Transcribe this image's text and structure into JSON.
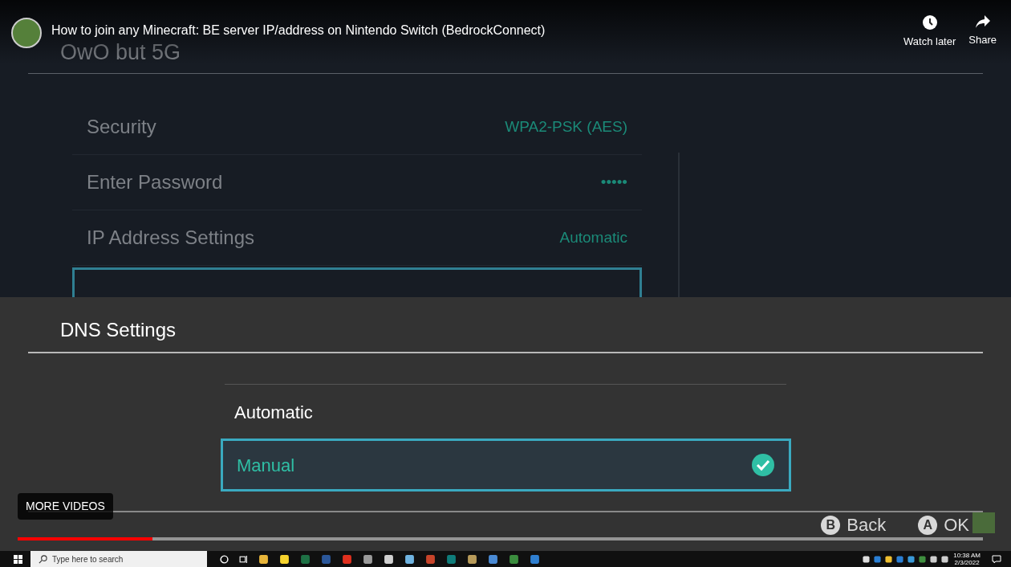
{
  "video": {
    "title": "How to join any Minecraft: BE server IP/address on Nintendo Switch (BedrockConnect)",
    "actions": [
      {
        "kind": "clock",
        "label": "Watch later"
      },
      {
        "kind": "share",
        "label": "Share"
      }
    ],
    "more_videos": "MORE VIDEOS",
    "progress": {
      "level": 0.14
    }
  },
  "switch": {
    "network_name": "OwO but 5G",
    "rows": [
      {
        "label": "Security",
        "value": "WPA2-PSK (AES)",
        "selected": false
      },
      {
        "label": "Enter Password",
        "value": "•••••",
        "selected": false
      },
      {
        "label": "IP Address Settings",
        "value": "Automatic",
        "selected": false
      },
      {
        "selected": true
      }
    ],
    "dialog": {
      "title": "DNS Settings",
      "options": [
        {
          "label": "Automatic",
          "selected": false
        },
        {
          "label": "Manual",
          "selected": true
        }
      ]
    },
    "buttons": [
      {
        "key": "B",
        "label": "Back"
      },
      {
        "key": "A",
        "label": "OK"
      }
    ]
  },
  "taskbar": {
    "search_placeholder": "Type here to search",
    "time": "10:38 AM",
    "date": "2/3/2022"
  }
}
